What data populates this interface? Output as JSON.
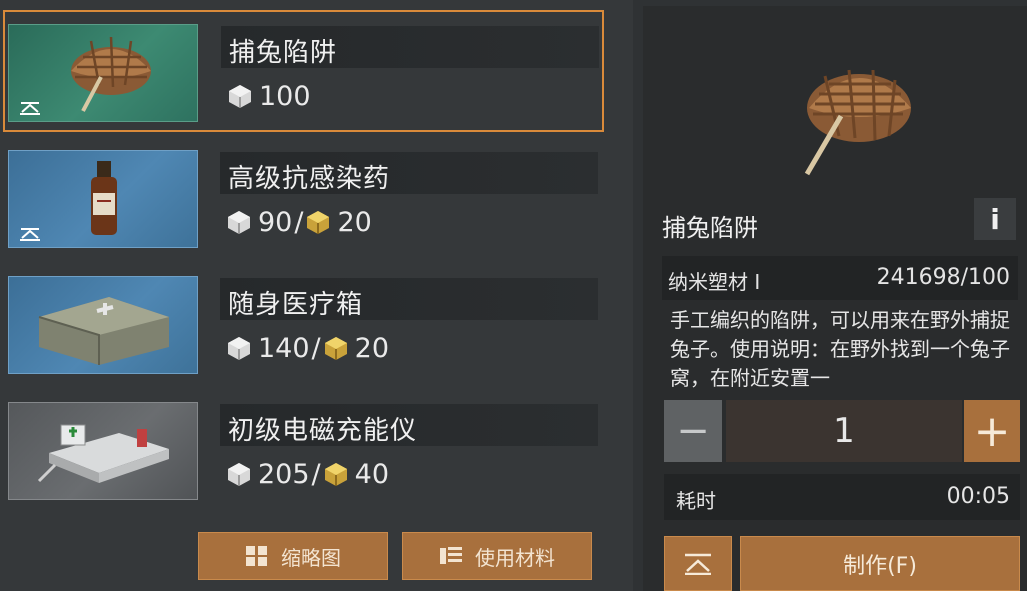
{
  "recipes": [
    {
      "name": "捕兔陷阱",
      "cost_a": "100",
      "cost_b": "",
      "thumb": "trap-icon",
      "selected": true
    },
    {
      "name": "高级抗感染药",
      "cost_a": "90",
      "cost_b": "20",
      "thumb": "medicine-bottle-icon",
      "selected": false
    },
    {
      "name": "随身医疗箱",
      "cost_a": "140",
      "cost_b": "20",
      "thumb": "medical-kit-icon",
      "selected": false
    },
    {
      "name": "初级电磁充能仪",
      "cost_a": "205",
      "cost_b": "40",
      "thumb": "charger-kit-icon",
      "selected": false
    }
  ],
  "separator": "/",
  "buttons": {
    "thumbnail_view": "缩略图",
    "use_materials": "使用材料",
    "craft": "制作(F)"
  },
  "detail": {
    "title": "捕兔陷阱",
    "info_label": "i",
    "material_name": "纳米塑材 I",
    "material_count": "241698/100",
    "description": "手工编织的陷阱，可以用来在野外捕捉兔子。使用说明：在野外找到一个兔子窝，在附近安置一",
    "quantity": "1",
    "qty_minus": "−",
    "qty_plus": "+",
    "time_label": "耗时",
    "time_value": "00:05"
  },
  "colors": {
    "accent": "#a8703d",
    "selected_border": "#d98a3a",
    "currency_b": "#e8c24a"
  }
}
